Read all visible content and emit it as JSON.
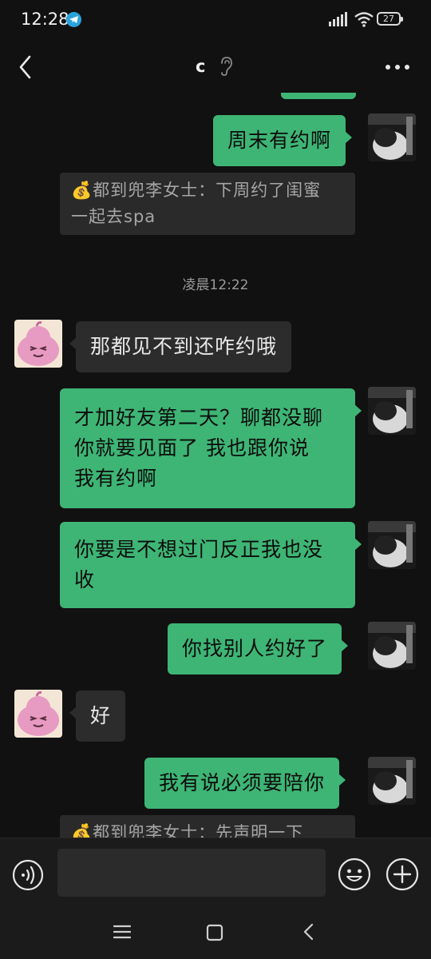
{
  "status_bar": {
    "time": "12:28",
    "battery": "27"
  },
  "header": {
    "title": "c"
  },
  "messages": [
    {
      "side": "me",
      "text": "周末有约啊"
    },
    {
      "type": "quote",
      "text": "💰都到兜李女士：下周约了闺蜜一起去spa",
      "line1": "💰都到兜李女士：下周约了闺蜜",
      "line2": "一起去spa"
    },
    {
      "type": "timestamp",
      "text": "凌晨12:22"
    },
    {
      "side": "them",
      "text": "那都见不到还咋约哦"
    },
    {
      "side": "me",
      "lines": [
        "才加好友第二天？聊都没聊",
        "你就要见面了 我也跟你说",
        "我有约啊"
      ]
    },
    {
      "side": "me",
      "lines": [
        "你要是不想过门反正我也没",
        "收"
      ]
    },
    {
      "side": "me",
      "text": "你找别人约好了"
    },
    {
      "side": "them",
      "text": "好"
    },
    {
      "side": "me",
      "text": "我有说必须要陪你"
    },
    {
      "type": "quote",
      "text": "💰都到兜李女士：先声明一下"
    }
  ],
  "input": {
    "placeholder": ""
  },
  "icons": {
    "back": "chevron-left-icon",
    "ear": "ear-icon",
    "more": "more-dots-icon",
    "voice": "voice-icon",
    "emoji": "emoji-icon",
    "plus": "plus-icon"
  },
  "colors": {
    "my_bubble": "#3eb575",
    "their_bubble": "#2c2c2c",
    "background": "#111111"
  }
}
